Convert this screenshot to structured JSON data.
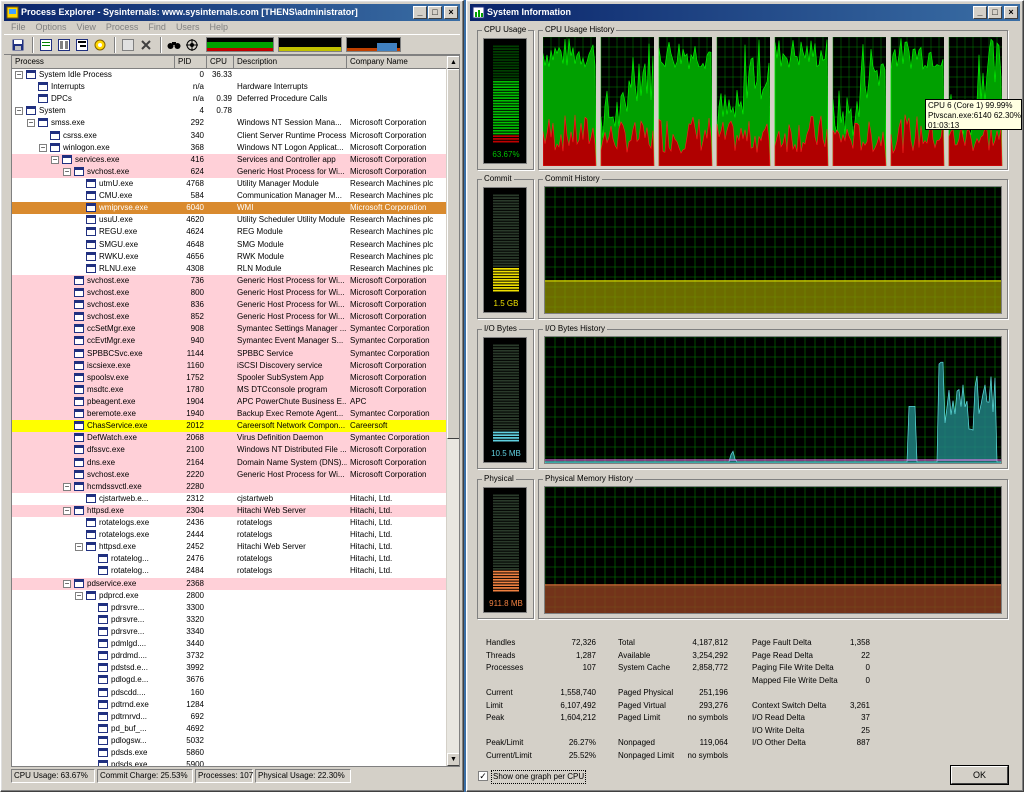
{
  "pe": {
    "title": "Process Explorer - Sysinternals: www.sysinternals.com [THENS\\administrator]",
    "menu": [
      "File",
      "Options",
      "View",
      "Process",
      "Find",
      "Users",
      "Help"
    ],
    "columns": [
      "Process",
      "PID",
      "CPU",
      "Description",
      "Company Name"
    ],
    "rows": [
      {
        "name": "System Idle Process",
        "pid": "0",
        "cpu": "36.33",
        "desc": "",
        "comp": "",
        "d": 0,
        "exp": "-",
        "hl": ""
      },
      {
        "name": "Interrupts",
        "pid": "n/a",
        "cpu": "",
        "desc": "Hardware Interrupts",
        "comp": "",
        "d": 1,
        "exp": "",
        "hl": ""
      },
      {
        "name": "DPCs",
        "pid": "n/a",
        "cpu": "0.39",
        "desc": "Deferred Procedure Calls",
        "comp": "",
        "d": 1,
        "exp": "",
        "hl": ""
      },
      {
        "name": "System",
        "pid": "4",
        "cpu": "0.78",
        "desc": "",
        "comp": "",
        "d": 0,
        "exp": "-",
        "hl": ""
      },
      {
        "name": "smss.exe",
        "pid": "292",
        "cpu": "",
        "desc": "Windows NT Session Mana...",
        "comp": "Microsoft Corporation",
        "d": 1,
        "exp": "-",
        "hl": ""
      },
      {
        "name": "csrss.exe",
        "pid": "340",
        "cpu": "",
        "desc": "Client Server Runtime Process",
        "comp": "Microsoft Corporation",
        "d": 2,
        "exp": "",
        "hl": ""
      },
      {
        "name": "winlogon.exe",
        "pid": "368",
        "cpu": "",
        "desc": "Windows NT Logon Applicat...",
        "comp": "Microsoft Corporation",
        "d": 2,
        "exp": "-",
        "hl": ""
      },
      {
        "name": "services.exe",
        "pid": "416",
        "cpu": "",
        "desc": "Services and Controller app",
        "comp": "Microsoft Corporation",
        "d": 3,
        "exp": "-",
        "hl": "pink"
      },
      {
        "name": "svchost.exe",
        "pid": "624",
        "cpu": "",
        "desc": "Generic Host Process for Wi...",
        "comp": "Microsoft Corporation",
        "d": 4,
        "exp": "-",
        "hl": "pink"
      },
      {
        "name": "utmU.exe",
        "pid": "4768",
        "cpu": "",
        "desc": "Utility Manager Module",
        "comp": "Research Machines plc",
        "d": 5,
        "exp": "",
        "hl": ""
      },
      {
        "name": "CMU.exe",
        "pid": "584",
        "cpu": "",
        "desc": "Communication Manager M...",
        "comp": "Research Machines plc",
        "d": 5,
        "exp": "",
        "hl": ""
      },
      {
        "name": "wmiprvse.exe",
        "pid": "6040",
        "cpu": "",
        "desc": "WMI",
        "comp": "Microsoft Corporation",
        "d": 5,
        "exp": "",
        "hl": "orange"
      },
      {
        "name": "usuU.exe",
        "pid": "4620",
        "cpu": "",
        "desc": "Utility Scheduler Utility Module",
        "comp": "Research Machines plc",
        "d": 5,
        "exp": "",
        "hl": ""
      },
      {
        "name": "REGU.exe",
        "pid": "4624",
        "cpu": "",
        "desc": "REG Module",
        "comp": "Research Machines plc",
        "d": 5,
        "exp": "",
        "hl": ""
      },
      {
        "name": "SMGU.exe",
        "pid": "4648",
        "cpu": "",
        "desc": "SMG Module",
        "comp": "Research Machines plc",
        "d": 5,
        "exp": "",
        "hl": ""
      },
      {
        "name": "RWKU.exe",
        "pid": "4656",
        "cpu": "",
        "desc": "RWK Module",
        "comp": "Research Machines plc",
        "d": 5,
        "exp": "",
        "hl": ""
      },
      {
        "name": "RLNU.exe",
        "pid": "4308",
        "cpu": "",
        "desc": "RLN Module",
        "comp": "Research Machines plc",
        "d": 5,
        "exp": "",
        "hl": ""
      },
      {
        "name": "svchost.exe",
        "pid": "736",
        "cpu": "",
        "desc": "Generic Host Process for Wi...",
        "comp": "Microsoft Corporation",
        "d": 4,
        "exp": "",
        "hl": "pink"
      },
      {
        "name": "svchost.exe",
        "pid": "800",
        "cpu": "",
        "desc": "Generic Host Process for Wi...",
        "comp": "Microsoft Corporation",
        "d": 4,
        "exp": "",
        "hl": "pink"
      },
      {
        "name": "svchost.exe",
        "pid": "836",
        "cpu": "",
        "desc": "Generic Host Process for Wi...",
        "comp": "Microsoft Corporation",
        "d": 4,
        "exp": "",
        "hl": "pink"
      },
      {
        "name": "svchost.exe",
        "pid": "852",
        "cpu": "",
        "desc": "Generic Host Process for Wi...",
        "comp": "Microsoft Corporation",
        "d": 4,
        "exp": "",
        "hl": "pink"
      },
      {
        "name": "ccSetMgr.exe",
        "pid": "908",
        "cpu": "",
        "desc": "Symantec Settings Manager ...",
        "comp": "Symantec Corporation",
        "d": 4,
        "exp": "",
        "hl": "pink"
      },
      {
        "name": "ccEvtMgr.exe",
        "pid": "940",
        "cpu": "",
        "desc": "Symantec Event Manager S...",
        "comp": "Symantec Corporation",
        "d": 4,
        "exp": "",
        "hl": "pink"
      },
      {
        "name": "SPBBCSvc.exe",
        "pid": "1144",
        "cpu": "",
        "desc": "SPBBC Service",
        "comp": "Symantec Corporation",
        "d": 4,
        "exp": "",
        "hl": "pink"
      },
      {
        "name": "iscsiexe.exe",
        "pid": "1160",
        "cpu": "",
        "desc": "iSCSI Discovery service",
        "comp": "Microsoft Corporation",
        "d": 4,
        "exp": "",
        "hl": "pink"
      },
      {
        "name": "spoolsv.exe",
        "pid": "1752",
        "cpu": "",
        "desc": "Spooler SubSystem App",
        "comp": "Microsoft Corporation",
        "d": 4,
        "exp": "",
        "hl": "pink"
      },
      {
        "name": "msdtc.exe",
        "pid": "1780",
        "cpu": "",
        "desc": "MS DTCconsole program",
        "comp": "Microsoft Corporation",
        "d": 4,
        "exp": "",
        "hl": "pink"
      },
      {
        "name": "pbeagent.exe",
        "pid": "1904",
        "cpu": "",
        "desc": "APC PowerChute Business E...",
        "comp": "APC",
        "d": 4,
        "exp": "",
        "hl": "pink"
      },
      {
        "name": "beremote.exe",
        "pid": "1940",
        "cpu": "",
        "desc": "Backup Exec Remote Agent...",
        "comp": "Symantec Corporation",
        "d": 4,
        "exp": "",
        "hl": "pink"
      },
      {
        "name": "ChasService.exe",
        "pid": "2012",
        "cpu": "",
        "desc": "Careersoft Network Compon...",
        "comp": "Careersoft",
        "d": 4,
        "exp": "",
        "hl": "yellow"
      },
      {
        "name": "DefWatch.exe",
        "pid": "2068",
        "cpu": "",
        "desc": "Virus Definition Daemon",
        "comp": "Symantec Corporation",
        "d": 4,
        "exp": "",
        "hl": "pink"
      },
      {
        "name": "dfssvc.exe",
        "pid": "2100",
        "cpu": "",
        "desc": "Windows NT Distributed File ...",
        "comp": "Microsoft Corporation",
        "d": 4,
        "exp": "",
        "hl": "pink"
      },
      {
        "name": "dns.exe",
        "pid": "2164",
        "cpu": "",
        "desc": "Domain Name System (DNS)...",
        "comp": "Microsoft Corporation",
        "d": 4,
        "exp": "",
        "hl": "pink"
      },
      {
        "name": "svchost.exe",
        "pid": "2220",
        "cpu": "",
        "desc": "Generic Host Process for Wi...",
        "comp": "Microsoft Corporation",
        "d": 4,
        "exp": "",
        "hl": "pink"
      },
      {
        "name": "hcmdssvctl.exe",
        "pid": "2280",
        "cpu": "",
        "desc": "",
        "comp": "",
        "d": 4,
        "exp": "-",
        "hl": "pink"
      },
      {
        "name": "cjstartweb.e...",
        "pid": "2312",
        "cpu": "",
        "desc": "cjstartweb",
        "comp": "Hitachi, Ltd.",
        "d": 5,
        "exp": "",
        "hl": ""
      },
      {
        "name": "httpsd.exe",
        "pid": "2304",
        "cpu": "",
        "desc": "Hitachi Web Server",
        "comp": "Hitachi, Ltd.",
        "d": 4,
        "exp": "-",
        "hl": "pink"
      },
      {
        "name": "rotatelogs.exe",
        "pid": "2436",
        "cpu": "",
        "desc": "rotatelogs",
        "comp": "Hitachi, Ltd.",
        "d": 5,
        "exp": "",
        "hl": ""
      },
      {
        "name": "rotatelogs.exe",
        "pid": "2444",
        "cpu": "",
        "desc": "rotatelogs",
        "comp": "Hitachi, Ltd.",
        "d": 5,
        "exp": "",
        "hl": ""
      },
      {
        "name": "httpsd.exe",
        "pid": "2452",
        "cpu": "",
        "desc": "Hitachi Web Server",
        "comp": "Hitachi, Ltd.",
        "d": 5,
        "exp": "-",
        "hl": ""
      },
      {
        "name": "rotatelog...",
        "pid": "2476",
        "cpu": "",
        "desc": "rotatelogs",
        "comp": "Hitachi, Ltd.",
        "d": 6,
        "exp": "",
        "hl": ""
      },
      {
        "name": "rotatelog...",
        "pid": "2484",
        "cpu": "",
        "desc": "rotatelogs",
        "comp": "Hitachi, Ltd.",
        "d": 6,
        "exp": "",
        "hl": ""
      },
      {
        "name": "pdservice.exe",
        "pid": "2368",
        "cpu": "",
        "desc": "",
        "comp": "",
        "d": 4,
        "exp": "-",
        "hl": "pink"
      },
      {
        "name": "pdprcd.exe",
        "pid": "2800",
        "cpu": "",
        "desc": "",
        "comp": "",
        "d": 5,
        "exp": "-",
        "hl": ""
      },
      {
        "name": "pdrsvre...",
        "pid": "3300",
        "cpu": "",
        "desc": "",
        "comp": "",
        "d": 6,
        "exp": "",
        "hl": ""
      },
      {
        "name": "pdrsvre...",
        "pid": "3320",
        "cpu": "",
        "desc": "",
        "comp": "",
        "d": 6,
        "exp": "",
        "hl": ""
      },
      {
        "name": "pdrsvre...",
        "pid": "3340",
        "cpu": "",
        "desc": "",
        "comp": "",
        "d": 6,
        "exp": "",
        "hl": ""
      },
      {
        "name": "pdmlgd....",
        "pid": "3440",
        "cpu": "",
        "desc": "",
        "comp": "",
        "d": 6,
        "exp": "",
        "hl": ""
      },
      {
        "name": "pdrdmd....",
        "pid": "3732",
        "cpu": "",
        "desc": "",
        "comp": "",
        "d": 6,
        "exp": "",
        "hl": ""
      },
      {
        "name": "pdstsd.e...",
        "pid": "3992",
        "cpu": "",
        "desc": "",
        "comp": "",
        "d": 6,
        "exp": "",
        "hl": ""
      },
      {
        "name": "pdlogd.e...",
        "pid": "3676",
        "cpu": "",
        "desc": "",
        "comp": "",
        "d": 6,
        "exp": "",
        "hl": ""
      },
      {
        "name": "pdscdd....",
        "pid": "160",
        "cpu": "",
        "desc": "",
        "comp": "",
        "d": 6,
        "exp": "",
        "hl": ""
      },
      {
        "name": "pdtrnd.exe",
        "pid": "1284",
        "cpu": "",
        "desc": "",
        "comp": "",
        "d": 6,
        "exp": "",
        "hl": ""
      },
      {
        "name": "pdtrnrvd...",
        "pid": "692",
        "cpu": "",
        "desc": "",
        "comp": "",
        "d": 6,
        "exp": "",
        "hl": ""
      },
      {
        "name": "pd_buf_...",
        "pid": "4692",
        "cpu": "",
        "desc": "",
        "comp": "",
        "d": 6,
        "exp": "",
        "hl": ""
      },
      {
        "name": "pdlogsw...",
        "pid": "5032",
        "cpu": "",
        "desc": "",
        "comp": "",
        "d": 6,
        "exp": "",
        "hl": ""
      },
      {
        "name": "pdsds.exe",
        "pid": "5860",
        "cpu": "",
        "desc": "",
        "comp": "",
        "d": 6,
        "exp": "",
        "hl": ""
      },
      {
        "name": "pdsds.exe",
        "pid": "5900",
        "cpu": "",
        "desc": "",
        "comp": "",
        "d": 6,
        "exp": "",
        "hl": ""
      }
    ],
    "status": {
      "cpu": "CPU Usage: 63.67%",
      "commit": "Commit Charge: 25.53%",
      "procs": "Processes: 107",
      "phys": "Physical Usage: 22.30%"
    }
  },
  "si": {
    "title": "System Information",
    "groups": {
      "cpu_usage": "CPU Usage",
      "cpu_history": "CPU Usage History",
      "commit": "Commit",
      "commit_history": "Commit History",
      "io": "I/O Bytes",
      "io_history": "I/O Bytes History",
      "physical": "Physical",
      "phys_history": "Physical Memory History"
    },
    "gauges": {
      "cpu": {
        "label": "63.67%",
        "level": 0.6367,
        "color": "#00c000"
      },
      "commit": {
        "label": "1.5 GB",
        "level": 0.255,
        "color": "#f0e000"
      },
      "io": {
        "label": "10.5 MB",
        "level": 0.12,
        "color": "#60d0e0"
      },
      "physical": {
        "label": "911.8 MB",
        "level": 0.223,
        "color": "#f08040"
      }
    },
    "tooltip": [
      "CPU 6 (Core 1) 99.99%",
      "Ptvscan.exe:6140 62.30%",
      "01:03:13"
    ],
    "stats": {
      "col1": [
        [
          "Handles",
          "72,326"
        ],
        [
          "Threads",
          "1,287"
        ],
        [
          "Processes",
          "107"
        ],
        [
          "",
          ""
        ],
        [
          "Current",
          "1,558,740"
        ],
        [
          "Limit",
          "6,107,492"
        ],
        [
          "Peak",
          "1,604,212"
        ],
        [
          "",
          ""
        ],
        [
          "Peak/Limit",
          "26.27%"
        ],
        [
          "Current/Limit",
          "25.52%"
        ]
      ],
      "col2": [
        [
          "Total",
          "4,187,812"
        ],
        [
          "Available",
          "3,254,292"
        ],
        [
          "System Cache",
          "2,858,772"
        ],
        [
          "",
          ""
        ],
        [
          "Paged Physical",
          "251,196"
        ],
        [
          "Paged Virtual",
          "293,276"
        ],
        [
          "Paged Limit",
          "no symbols"
        ],
        [
          "",
          ""
        ],
        [
          "Nonpaged",
          "119,064"
        ],
        [
          "Nonpaged Limit",
          "no symbols"
        ]
      ],
      "col3": [
        [
          "Page Fault Delta",
          "1,358"
        ],
        [
          "Page Read Delta",
          "22"
        ],
        [
          "Paging File Write Delta",
          "0"
        ],
        [
          "Mapped File Write Delta",
          "0"
        ],
        [
          "",
          ""
        ],
        [
          "Context Switch Delta",
          "3,261"
        ],
        [
          "I/O Read Delta",
          "37"
        ],
        [
          "I/O Write Delta",
          "25"
        ],
        [
          "I/O Other Delta",
          "887"
        ]
      ]
    },
    "checkbox_label": "Show one graph per CPU",
    "ok_label": "OK"
  }
}
